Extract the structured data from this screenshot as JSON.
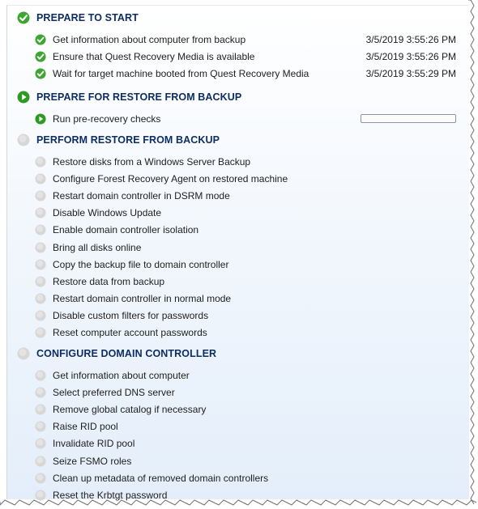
{
  "sections": [
    {
      "title": "PREPARE TO START",
      "status": "done",
      "items": [
        {
          "label": "Get information about computer from backup",
          "status": "done",
          "time": "3/5/2019 3:55:26 PM"
        },
        {
          "label": "Ensure that Quest Recovery Media is available",
          "status": "done",
          "time": "3/5/2019 3:55:26 PM"
        },
        {
          "label": "Wait for target machine booted from Quest Recovery Media",
          "status": "done",
          "time": "3/5/2019 3:55:29 PM"
        }
      ]
    },
    {
      "title": "PREPARE FOR RESTORE FROM BACKUP",
      "status": "running",
      "items": [
        {
          "label": "Run pre-recovery checks",
          "status": "running",
          "progress": 0
        }
      ]
    },
    {
      "title": "PERFORM RESTORE FROM BACKUP",
      "status": "pending",
      "items": [
        {
          "label": "Restore disks from a Windows Server Backup",
          "status": "pending"
        },
        {
          "label": "Configure Forest Recovery Agent on restored machine",
          "status": "pending"
        },
        {
          "label": "Restart domain controller in DSRM mode",
          "status": "pending"
        },
        {
          "label": "Disable Windows Update",
          "status": "pending"
        },
        {
          "label": "Enable domain controller isolation",
          "status": "pending"
        },
        {
          "label": "Bring all disks online",
          "status": "pending"
        },
        {
          "label": "Copy the backup file to domain controller",
          "status": "pending"
        },
        {
          "label": "Restore data from backup",
          "status": "pending"
        },
        {
          "label": "Restart domain controller in normal mode",
          "status": "pending"
        },
        {
          "label": "Disable custom filters for passwords",
          "status": "pending"
        },
        {
          "label": "Reset computer account passwords",
          "status": "pending"
        }
      ]
    },
    {
      "title": "CONFIGURE DOMAIN CONTROLLER",
      "status": "pending",
      "items": [
        {
          "label": "Get information about computer",
          "status": "pending"
        },
        {
          "label": "Select preferred DNS server",
          "status": "pending"
        },
        {
          "label": "Remove global catalog if necessary",
          "status": "pending"
        },
        {
          "label": "Raise RID pool",
          "status": "pending"
        },
        {
          "label": "Invalidate RID pool",
          "status": "pending"
        },
        {
          "label": "Seize FSMO roles",
          "status": "pending"
        },
        {
          "label": "Clean up metadata of removed domain controllers",
          "status": "pending"
        },
        {
          "label": "Reset the Krbtgt password",
          "status": "pending"
        }
      ]
    }
  ],
  "colors": {
    "done": "#3ea532",
    "running": "#2e9a24",
    "pending": "#d7d7d7",
    "section_title": "#0d2e63"
  },
  "icons": {
    "done": "check-circle-icon",
    "running": "play-circle-icon",
    "pending": "pending-circle-icon"
  }
}
